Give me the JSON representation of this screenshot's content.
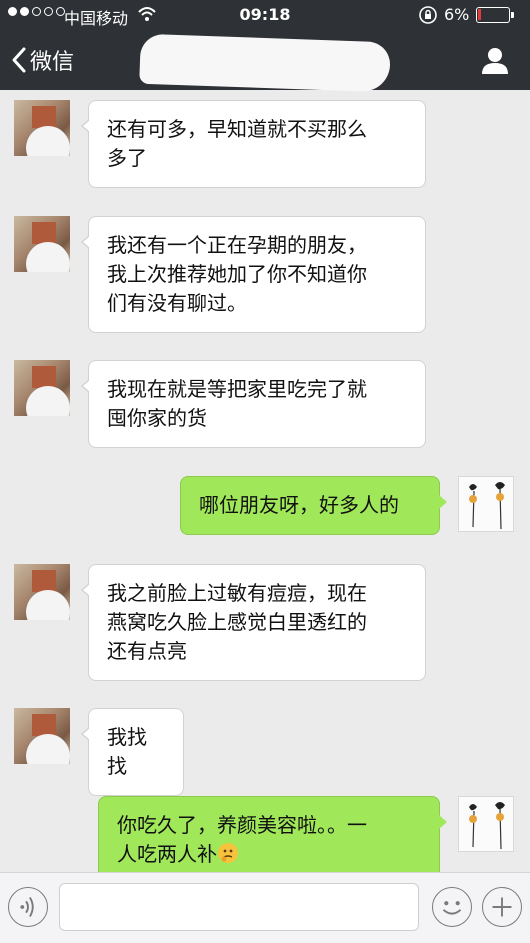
{
  "status_bar": {
    "carrier": "中国移动",
    "time": "09:18",
    "battery": "6%"
  },
  "nav": {
    "back_label": "微信"
  },
  "messages": [
    {
      "side": "left",
      "lines": [
        "还有可多，早知道就不买那么",
        "多了"
      ]
    },
    {
      "side": "left",
      "lines": [
        "我还有一个正在孕期的朋友，",
        "我上次推荐她加了你不知道你",
        "们有没有聊过。"
      ]
    },
    {
      "side": "left",
      "lines": [
        "我现在就是等把家里吃完了就",
        "囤你家的货"
      ]
    },
    {
      "side": "right",
      "lines": [
        "哪位朋友呀，好多人的"
      ]
    },
    {
      "side": "left",
      "lines": [
        "我之前脸上过敏有痘痘，现在",
        "燕窝吃久脸上感觉白里透红的",
        "还有点亮"
      ]
    },
    {
      "side": "left",
      "lines": [
        "我找找"
      ]
    },
    {
      "side": "right",
      "lines": [
        "你吃久了，养颜美容啦。。一",
        "人吃两人补"
      ],
      "trailing_icon": "thinking-face-emoji"
    }
  ],
  "input_bar": {
    "value": ""
  }
}
